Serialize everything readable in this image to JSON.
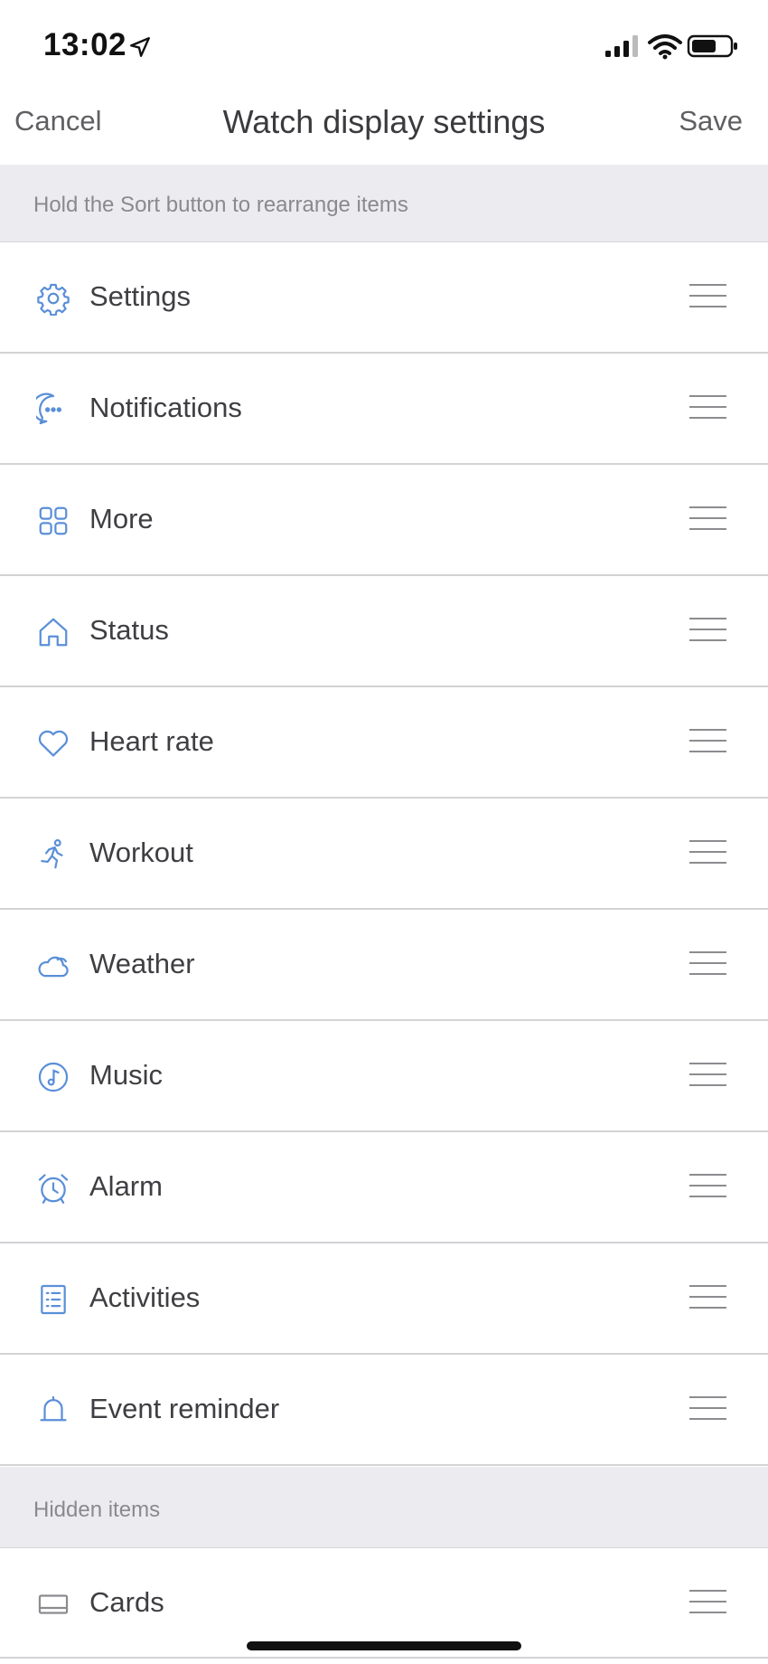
{
  "status_bar": {
    "time": "13:02"
  },
  "nav": {
    "cancel": "Cancel",
    "title": "Watch display settings",
    "save": "Save"
  },
  "visible_section": {
    "hint": "Hold the Sort button to rearrange items"
  },
  "items": [
    {
      "label": "Settings",
      "icon": "gear-icon"
    },
    {
      "label": "Notifications",
      "icon": "chat-bubble-icon"
    },
    {
      "label": "More",
      "icon": "grid-icon"
    },
    {
      "label": "Status",
      "icon": "home-icon"
    },
    {
      "label": "Heart rate",
      "icon": "heart-icon"
    },
    {
      "label": "Workout",
      "icon": "running-icon"
    },
    {
      "label": "Weather",
      "icon": "cloud-icon"
    },
    {
      "label": "Music",
      "icon": "music-note-icon"
    },
    {
      "label": "Alarm",
      "icon": "alarm-clock-icon"
    },
    {
      "label": "Activities",
      "icon": "list-icon"
    },
    {
      "label": "Event reminder",
      "icon": "bell-icon"
    }
  ],
  "hidden_section": {
    "title": "Hidden items",
    "items": [
      {
        "label": "Cards",
        "icon": "card-icon"
      }
    ]
  },
  "colors": {
    "accent_icon": "#5a8fd8",
    "section_bg": "#ececf0",
    "divider": "#d3d3d6"
  }
}
